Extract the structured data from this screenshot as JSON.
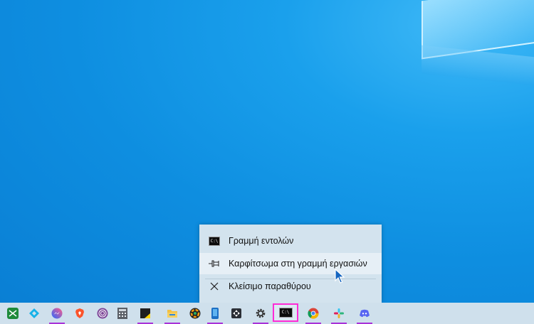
{
  "context_menu": {
    "app_title": "Γραμμή εντολών",
    "app_icon_text": "C:\\",
    "items": [
      {
        "label": "Καρφίτσωμα στη γραμμή εργασιών",
        "icon": "pin-icon"
      },
      {
        "label": "Κλείσιμο παραθύρου",
        "icon": "close-icon"
      }
    ]
  },
  "taskbar": {
    "active_app": "cmd",
    "cmd_icon_text": "C:\\",
    "apps": [
      {
        "name": "excel-like-app",
        "icon": "grid-app-icon",
        "running": false
      },
      {
        "name": "kodi",
        "icon": "kodi-icon",
        "running": false
      },
      {
        "name": "messenger",
        "icon": "messenger-icon",
        "running": true
      },
      {
        "name": "brave",
        "icon": "brave-icon",
        "running": false
      },
      {
        "name": "tor-browser",
        "icon": "tor-icon",
        "running": false
      },
      {
        "name": "calculator",
        "icon": "calculator-icon",
        "running": false
      },
      {
        "name": "sticky-notes",
        "icon": "sticky-notes-icon",
        "running": true
      },
      {
        "name": "file-explorer",
        "icon": "folder-icon",
        "running": true
      },
      {
        "name": "color-picker",
        "icon": "color-wheel-icon",
        "running": false
      },
      {
        "name": "phone-link",
        "icon": "phone-icon",
        "running": true
      },
      {
        "name": "game-controller",
        "icon": "gamepad-icon",
        "running": false
      },
      {
        "name": "settings",
        "icon": "gear-icon",
        "running": true
      },
      {
        "name": "cmd",
        "icon": "cmd-icon",
        "running": true
      },
      {
        "name": "chrome",
        "icon": "chrome-icon",
        "running": true
      },
      {
        "name": "slack",
        "icon": "slack-icon",
        "running": true
      },
      {
        "name": "discord",
        "icon": "discord-icon",
        "running": true
      }
    ]
  },
  "colors": {
    "desktop": "#0e8ee0",
    "taskbar": "#cfe0ec",
    "menu": "#d3e3ee",
    "running_indicator": "#a832d8",
    "highlight_box": "#ff2bd6"
  }
}
